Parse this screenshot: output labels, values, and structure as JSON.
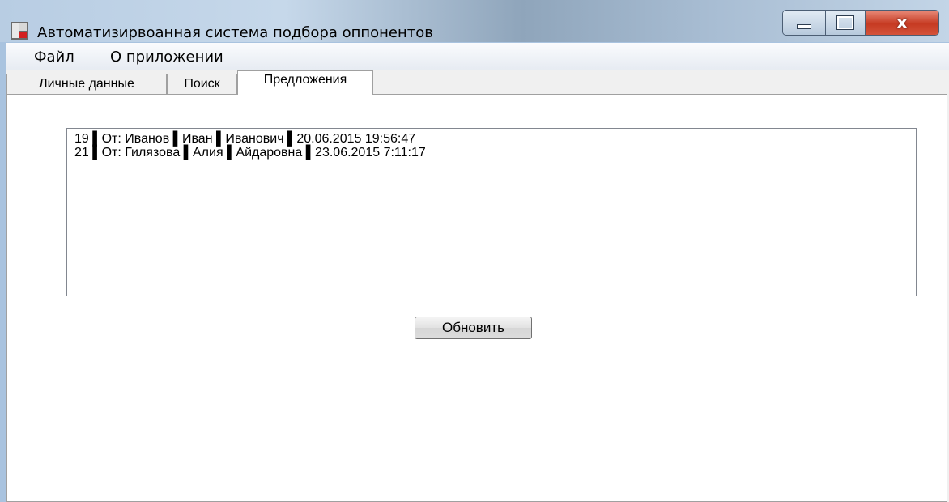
{
  "window": {
    "title": "Автоматизирвоанная система подбора оппонентов",
    "controls": {
      "minimize": "",
      "maximize": "",
      "close": "x"
    }
  },
  "menu": [
    {
      "label": "Файл"
    },
    {
      "label": "О приложении"
    }
  ],
  "tabs": [
    {
      "label": "Личные данные",
      "active": false
    },
    {
      "label": "Поиск",
      "active": false
    },
    {
      "label": "Предложения",
      "active": true
    }
  ],
  "proposals": {
    "items": [
      "19 ▌От: Иванов ▌Иван ▌Иванович ▌20.06.2015 19:56:47",
      "21 ▌От: Гилязова ▌Алия ▌Айдаровна ▌23.06.2015 7:11:17"
    ],
    "refresh_label": "Обновить"
  },
  "colors": {
    "frame": "#a9c3df",
    "panel": "#ffffff",
    "close_button": "#c63a22"
  },
  "icons": {
    "app": "app-icon",
    "minimize": "minimize-icon",
    "maximize": "maximize-icon",
    "close": "close-icon"
  }
}
